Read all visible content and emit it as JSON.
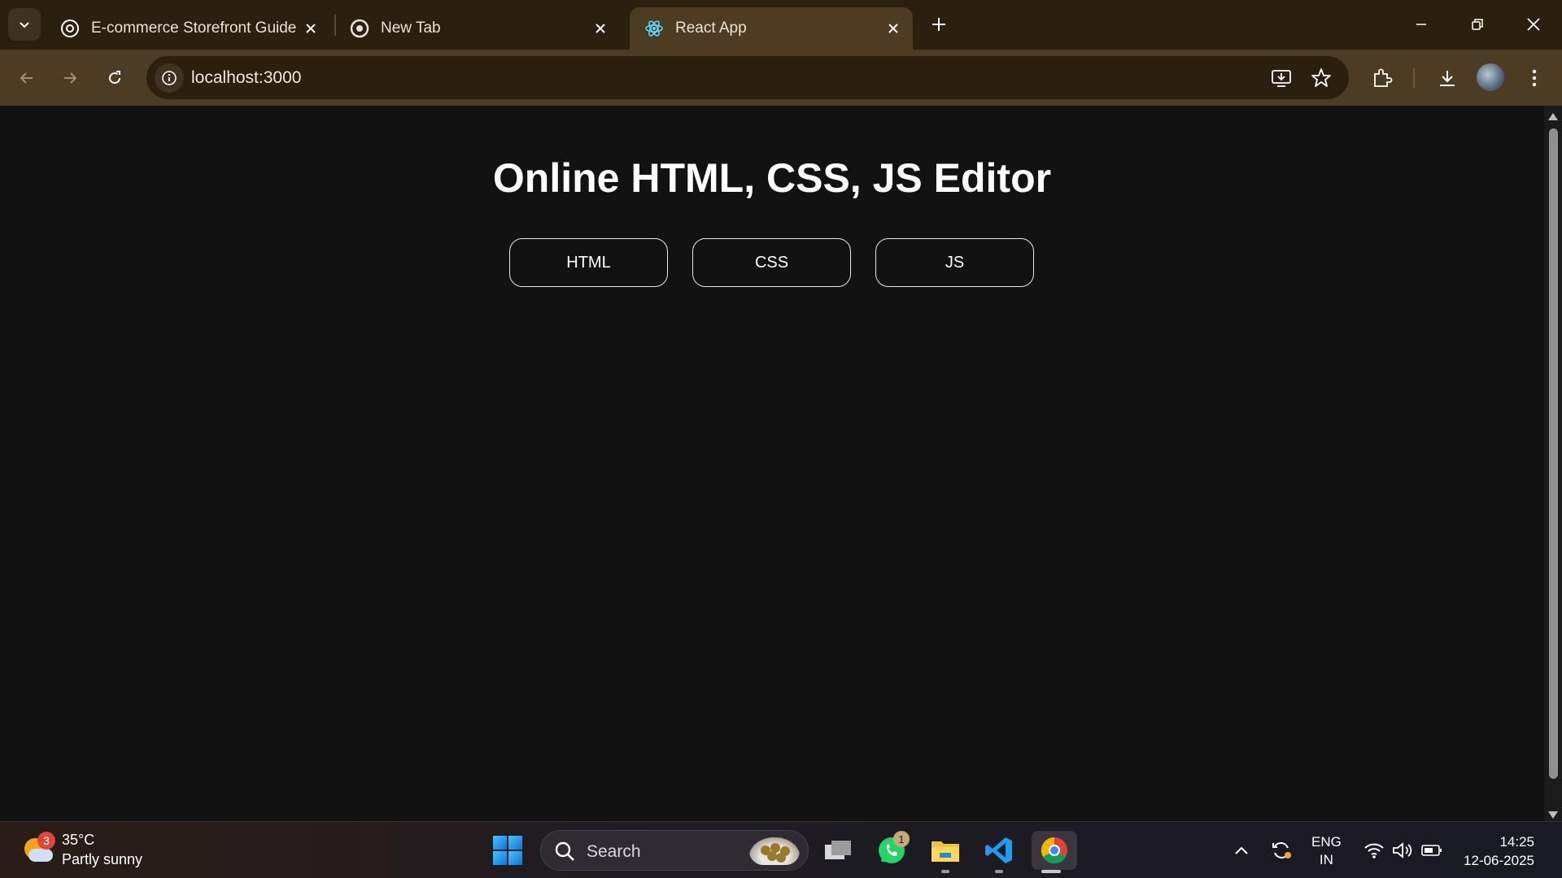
{
  "browser": {
    "tabs": [
      {
        "title": "E-commerce Storefront Guide",
        "icon": "chatgpt-icon",
        "active": false
      },
      {
        "title": "New Tab",
        "icon": "chrome-icon",
        "active": false
      },
      {
        "title": "React App",
        "icon": "react-icon",
        "active": true
      }
    ],
    "url": "localhost:3000"
  },
  "page": {
    "title": "Online HTML, CSS, JS Editor",
    "buttons": [
      "HTML",
      "CSS",
      "JS"
    ]
  },
  "taskbar": {
    "weather": {
      "temp": "35°C",
      "condition": "Partly sunny",
      "badge": "3"
    },
    "search_placeholder": "Search",
    "whatsapp_badge": "1",
    "language": {
      "line1": "ENG",
      "line2": "IN"
    },
    "time": "14:25",
    "date": "12-06-2025"
  },
  "colors": {
    "tabstrip": "#2b1f0e",
    "toolbar": "#4d3c24",
    "page_bg": "#121212",
    "accent_windows": "#0a76d8"
  }
}
